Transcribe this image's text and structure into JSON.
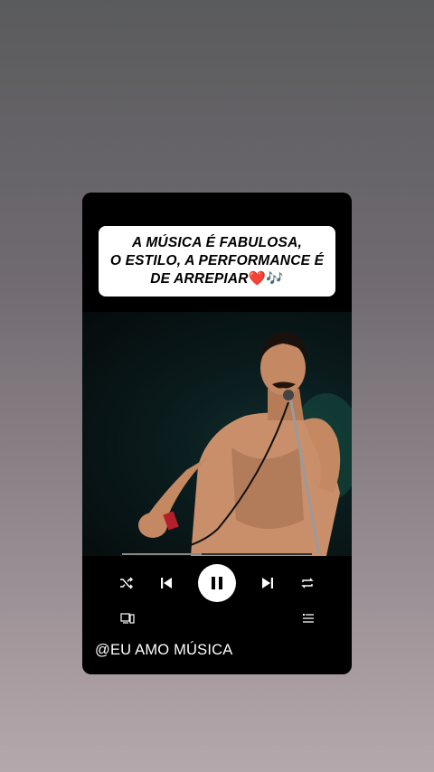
{
  "caption": {
    "line1": "A MÚSICA É FABULOSA,",
    "line2": "O ESTILO, A PERFORMANCE É",
    "line3": "DE ARREPIAR",
    "emoji_heart": "❤️",
    "emoji_notes": "🎶"
  },
  "player": {
    "progress": 0.42,
    "state": "playing",
    "icons": [
      "shuffle-icon",
      "previous-icon",
      "pause-icon",
      "next-icon",
      "repeat-icon",
      "devices-icon",
      "queue-icon"
    ]
  },
  "handle": "@EU AMO MÚSICA",
  "colors": {
    "card": "#000000",
    "caption_bg": "#ffffff",
    "heart": "#e0192b"
  }
}
